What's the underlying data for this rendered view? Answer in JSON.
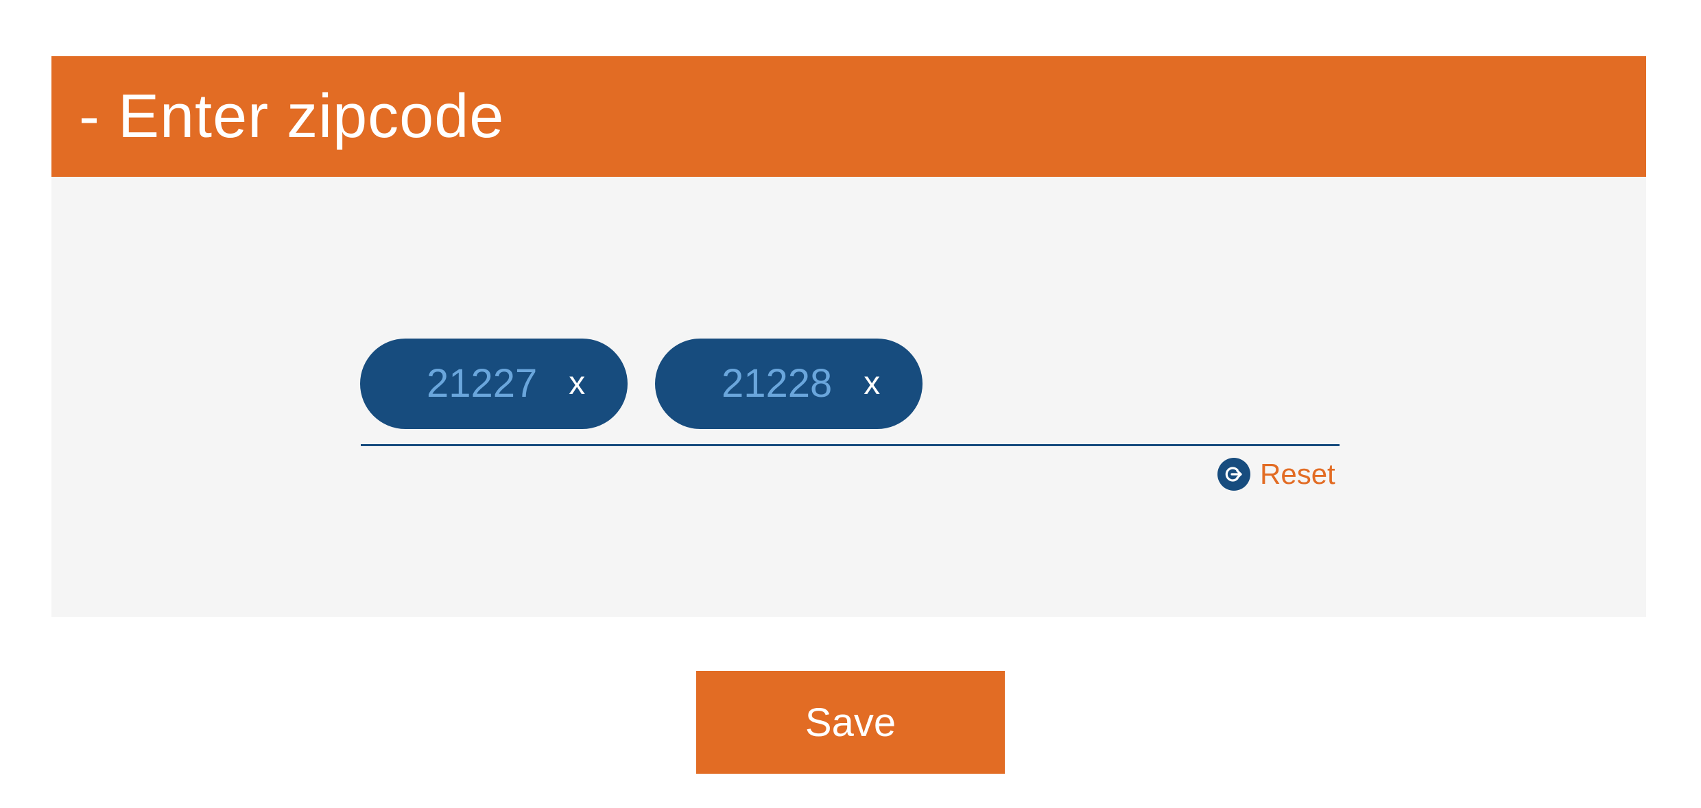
{
  "panel": {
    "title": "- Enter zipcode"
  },
  "zipcodes": [
    {
      "value": "21227",
      "remove_label": "x"
    },
    {
      "value": "21228",
      "remove_label": "x"
    }
  ],
  "reset": {
    "label": "Reset",
    "icon": "reset-icon"
  },
  "save": {
    "label": "Save"
  },
  "colors": {
    "accent": "#e26c24",
    "chip": "#174c7e",
    "chip_text": "#6aa6dc",
    "panel_bg": "#f5f5f5"
  }
}
